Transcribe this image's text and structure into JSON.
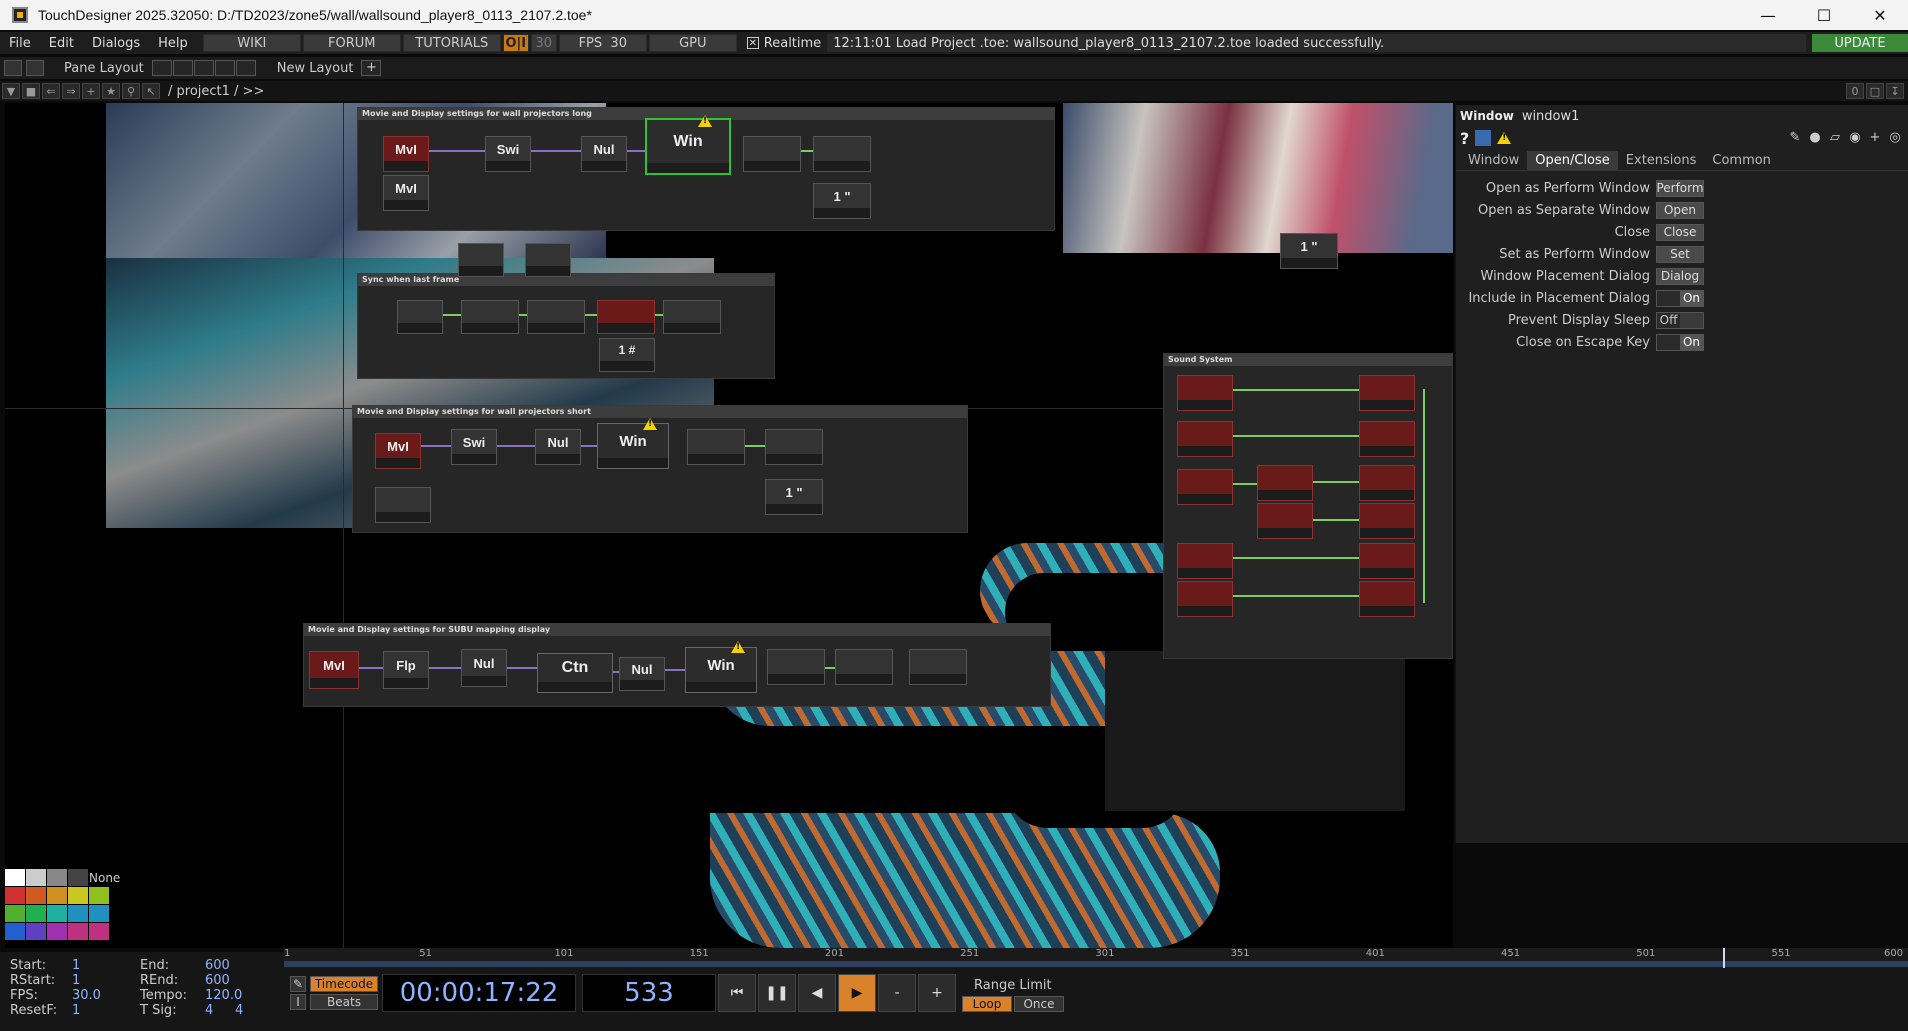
{
  "window": {
    "title": "TouchDesigner 2025.32050: D:/TD2023/zone5/wall/wallsound_player8_0113_2107.2.toe*"
  },
  "menubar": {
    "items": [
      "File",
      "Edit",
      "Dialogs",
      "Help"
    ],
    "links": [
      "WIKI",
      "FORUM",
      "TUTORIALS"
    ],
    "oi": "O|I",
    "fps_target": "30",
    "fps_label": "FPS",
    "fps_value": "30",
    "gpu": "GPU",
    "realtime_label": "Realtime",
    "realtime_checked": true,
    "status": "12:11:01 Load Project .toe: wallsound_player8_0113_2107.2.toe loaded successfully.",
    "update": "UPDATE"
  },
  "panebar": {
    "pane_layout": "Pane Layout",
    "new_layout": "New Layout"
  },
  "pathbar": {
    "path": "/ project1 / >>",
    "counter": "0"
  },
  "netboxes": [
    {
      "title": "Movie and Display settings for wall projectors long"
    },
    {
      "title": "Sync when last frame"
    },
    {
      "title": "Movie and Display settings for wall projectors short"
    },
    {
      "title": "Movie and Display settings for SUBU mapping display"
    },
    {
      "title": "Sound System"
    }
  ],
  "operators": {
    "mvi1": "MvI",
    "mvi2": "MvI",
    "swi1": "Swi",
    "nul1": "Nul",
    "win1": "Win",
    "val1": "1 \"",
    "hash1": "1 #",
    "val_float": "1 \"",
    "mvi3": "MvI",
    "swi2": "Swi",
    "nul2": "Nul",
    "win2": "Win",
    "val2": "1 \"",
    "mvi4": "MvI",
    "flp": "Flp",
    "nul3": "Nul",
    "ctn": "Ctn",
    "nul4": "Nul",
    "win3": "Win"
  },
  "params": {
    "type": "Window",
    "name": "window1",
    "tabs": [
      "Window",
      "Open/Close",
      "Extensions",
      "Common"
    ],
    "active_tab": "Open/Close",
    "rows": [
      {
        "label": "Open as Perform Window",
        "kind": "button",
        "value": "Perform"
      },
      {
        "label": "Open as Separate Window",
        "kind": "button",
        "value": "Open"
      },
      {
        "label": "Close",
        "kind": "button",
        "value": "Close"
      },
      {
        "label": "Set as Perform Window",
        "kind": "button",
        "value": "Set"
      },
      {
        "label": "Window Placement Dialog",
        "kind": "button",
        "value": "Dialog"
      },
      {
        "label": "Include in Placement Dialog",
        "kind": "toggle",
        "value": "On"
      },
      {
        "label": "Prevent Display Sleep",
        "kind": "toggle",
        "value": "Off"
      },
      {
        "label": "Close on Escape Key",
        "kind": "toggle",
        "value": "On"
      }
    ]
  },
  "palette": {
    "none": "None",
    "colors": [
      "#ffffff",
      "#cccccc",
      "#888888",
      "#444444",
      "#d03030",
      "#d05a20",
      "#d09020",
      "#c8c820",
      "#90c020",
      "#50b030",
      "#20b050",
      "#20b0a0",
      "#2090c0",
      "#2060d0",
      "#6040c0",
      "#a030b0",
      "#c03080"
    ]
  },
  "timeline": {
    "ticks": [
      "1",
      "51",
      "101",
      "151",
      "201",
      "251",
      "301",
      "351",
      "401",
      "451",
      "501",
      "551",
      "600"
    ],
    "current_frame": 533,
    "start": 1,
    "end": 600
  },
  "info": {
    "start_label": "Start:",
    "start": "1",
    "end_label": "End:",
    "end": "600",
    "rstart_label": "RStart:",
    "rstart": "1",
    "rend_label": "REnd:",
    "rend": "600",
    "fps_label": "FPS:",
    "fps": "30.0",
    "tempo_label": "Tempo:",
    "tempo": "120.0",
    "resetf_label": "ResetF:",
    "resetf": "1",
    "tsig_label": "T Sig:",
    "tsig_a": "4",
    "tsig_b": "4"
  },
  "transport": {
    "timecode": "Timecode",
    "beats": "Beats",
    "time": "00:00:17:22",
    "frame": "533",
    "minus": "-",
    "plus": "+",
    "range_limit": "Range Limit",
    "loop": "Loop",
    "once": "Once"
  }
}
